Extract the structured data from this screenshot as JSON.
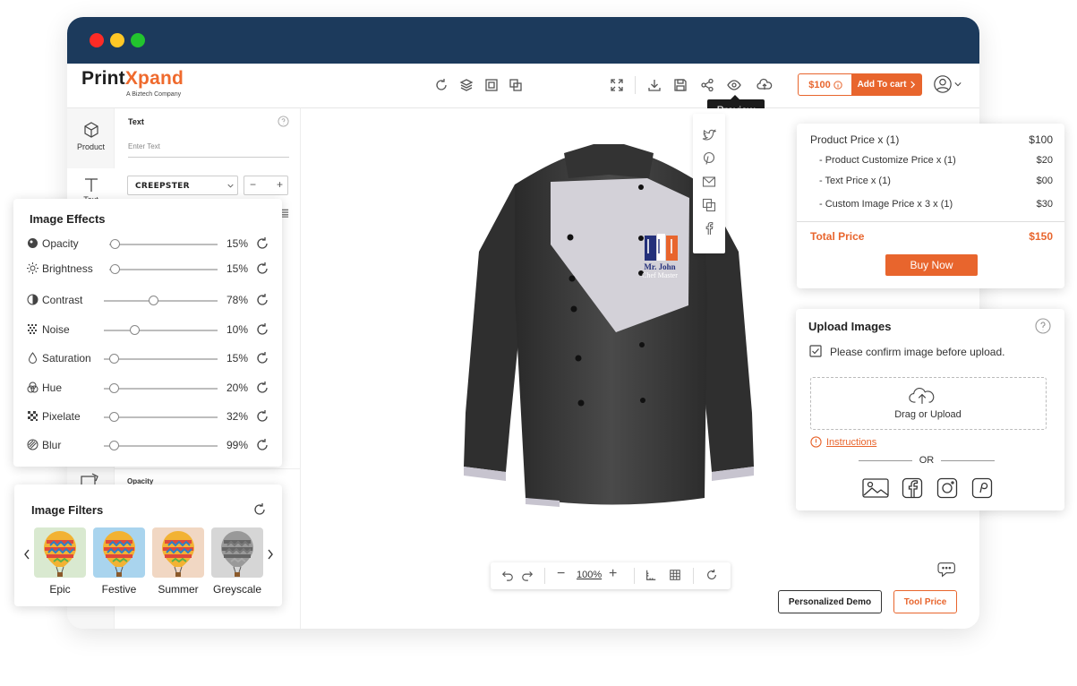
{
  "brand": {
    "name_part1": "Print",
    "name_part2": "Xpand",
    "tagline": "A Biztech Company"
  },
  "header": {
    "price": "$100",
    "add_to_cart": "Add To cart",
    "preview_tooltip": "Preview"
  },
  "sidebar": {
    "items": [
      {
        "label": "Product"
      },
      {
        "label": "Text"
      }
    ]
  },
  "text_panel": {
    "title": "Text",
    "input_placeholder": "Enter Text",
    "font_select": "CREEPSTER",
    "opacity_label": "Opacity"
  },
  "product": {
    "logo_line1": "Mr. John",
    "logo_line2": "Chef Master"
  },
  "zoom": {
    "value": "100%"
  },
  "buttons": {
    "personalized_demo": "Personalized Demo",
    "tool_price": "Tool Price"
  },
  "pricing": {
    "rows": [
      {
        "label": "Product Price  x  (1)",
        "value": "$100"
      },
      {
        "label": "- Product Customize Price  x  (1)",
        "value": "$20"
      },
      {
        "label": "- Text Price x (1)",
        "value": "$00"
      },
      {
        "label": "- Custom Image Price x 3 x  (1)",
        "value": "$30"
      }
    ],
    "total_label": "Total Price",
    "total_value": "$150",
    "buy_now": "Buy Now"
  },
  "upload": {
    "title": "Upload Images",
    "confirm_label": "Please confirm image before upload.",
    "drop_label": "Drag or Upload",
    "instructions": "Instructions",
    "or": "OR"
  },
  "image_effects": {
    "title": "Image Effects",
    "items": [
      {
        "label": "Opacity",
        "value": "15%",
        "level": 0.05,
        "icon": "opacity-icon"
      },
      {
        "label": "Brightness",
        "value": "15%",
        "level": 0.05,
        "icon": "brightness-icon"
      },
      {
        "label": "Contrast",
        "value": "78%",
        "level": 0.43,
        "icon": "contrast-icon"
      },
      {
        "label": "Noise",
        "value": "10%",
        "level": 0.27,
        "icon": "noise-icon"
      },
      {
        "label": "Saturation",
        "value": "15%",
        "level": 0.09,
        "icon": "saturation-icon"
      },
      {
        "label": "Hue",
        "value": "20%",
        "level": 0.09,
        "icon": "hue-icon"
      },
      {
        "label": "Pixelate",
        "value": "32%",
        "level": 0.09,
        "icon": "pixelate-icon"
      },
      {
        "label": "Blur",
        "value": "99%",
        "level": 0.09,
        "icon": "blur-icon"
      }
    ]
  },
  "image_filters": {
    "title": "Image Filters",
    "items": [
      {
        "label": "Epic",
        "tint": "#d9e9d0"
      },
      {
        "label": "Festive",
        "tint": "#a9d4ee"
      },
      {
        "label": "Summer",
        "tint": "#f1d7c3"
      },
      {
        "label": "Greyscale",
        "tint": "#d6d6d6"
      }
    ]
  },
  "colors": {
    "accent": "#e8652d",
    "titlebar": "#1c3a5c"
  }
}
